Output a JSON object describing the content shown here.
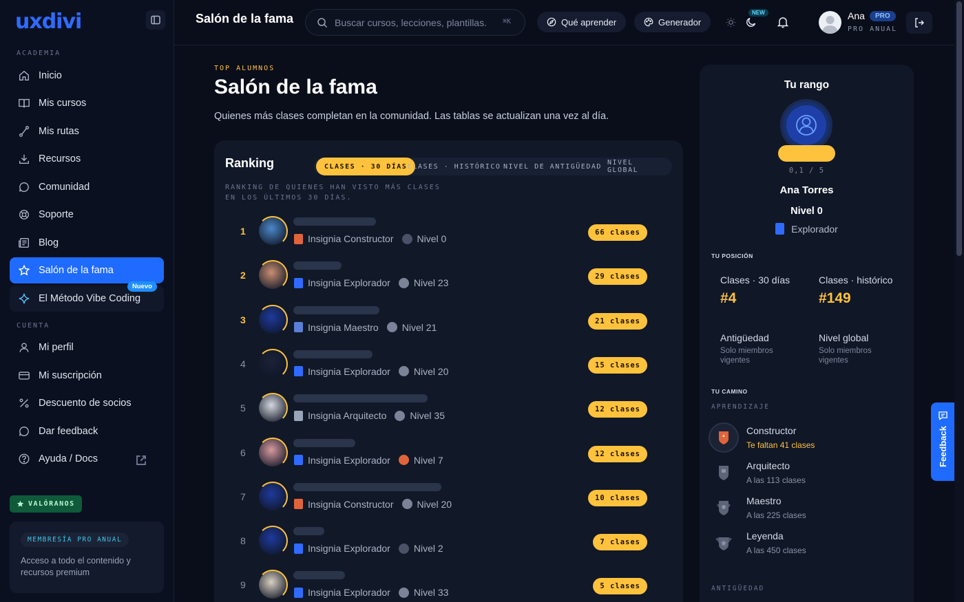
{
  "brand": {
    "logo_text": "uxdivi",
    "accent": "#1f6bff",
    "gold": "#ffc23d"
  },
  "sidebar": {
    "section_academia": "ACADEMIA",
    "items": [
      {
        "label": "Inicio",
        "icon": "home-icon"
      },
      {
        "label": "Mis cursos",
        "icon": "book-icon"
      },
      {
        "label": "Mis rutas",
        "icon": "route-icon"
      },
      {
        "label": "Recursos",
        "icon": "download-icon"
      },
      {
        "label": "Comunidad",
        "icon": "chat-icon"
      },
      {
        "label": "Soporte",
        "icon": "lifebuoy-icon"
      },
      {
        "label": "Blog",
        "icon": "newspaper-icon"
      },
      {
        "label": "Salón de la fama",
        "icon": "star-icon"
      },
      {
        "label": "El Método Vibe Coding",
        "icon": "sparkle-icon",
        "badge": "Nuevo"
      }
    ],
    "section_cuenta": "CUENTA",
    "account_items": [
      {
        "label": "Mi perfil",
        "icon": "user-icon"
      },
      {
        "label": "Mi suscripción",
        "icon": "card-icon"
      },
      {
        "label": "Descuento de socios",
        "icon": "percent-icon"
      },
      {
        "label": "Dar feedback",
        "icon": "chat-icon"
      },
      {
        "label": "Ayuda / Docs",
        "icon": "help-icon"
      }
    ],
    "valoranos": "VALÓRANOS",
    "membership": {
      "pill": "MEMBRESÍA PRO ANUAL",
      "desc": "Acceso a todo el contenido y recursos premium"
    }
  },
  "topbar": {
    "title": "Salón de la fama",
    "search_placeholder": "Buscar cursos, lecciones, plantillas...",
    "search_kbd": "⌘K",
    "que_aprender": "Qué aprender",
    "generador": "Generador",
    "new_badge": "NEW",
    "user": {
      "name": "Ana",
      "badge": "PRO",
      "plan": "PRO ANUAL"
    }
  },
  "main": {
    "eyebrow": "TOP ALUMNOS",
    "title": "Salón de la fama",
    "subtitle": "Quienes más clases completan en la comunidad. Las tablas se actualizan una vez al día."
  },
  "ranking": {
    "title": "Ranking",
    "tabs": [
      "CLASES · 30 DÍAS",
      "CLASES · HISTÓRICO",
      "NIVEL DE ANTIGÜEDAD",
      "NIVEL GLOBAL"
    ],
    "description": "RANKING DE QUIENES HAN VISTO MÁS CLASES EN LOS ÚLTIMOS 30 DÍAS.",
    "rows": [
      {
        "pos": "1",
        "insignia": "Insignia Constructor",
        "insignia_color": "#e0643a",
        "level": "Nivel 0",
        "level_color": "#4a5268",
        "classes": "66 clases",
        "avatar": "#4b87c7"
      },
      {
        "pos": "2",
        "insignia": "Insignia Explorador",
        "insignia_color": "#2f6bff",
        "level": "Nivel 23",
        "level_color": "#7a8398",
        "classes": "29 clases",
        "avatar": "#c98f72"
      },
      {
        "pos": "3",
        "insignia": "Insignia Maestro",
        "insignia_color": "#5b7fd6",
        "level": "Nivel 21",
        "level_color": "#7a8398",
        "classes": "21 clases",
        "avatar": "#1e3a9c"
      },
      {
        "pos": "4",
        "insignia": "Insignia Explorador",
        "insignia_color": "#2f6bff",
        "level": "Nivel 20",
        "level_color": "#7a8398",
        "classes": "15 clases",
        "avatar": "#1b2238"
      },
      {
        "pos": "5",
        "insignia": "Insignia Arquitecto",
        "insignia_color": "#9aa4b8",
        "level": "Nivel 35",
        "level_color": "#7a8398",
        "classes": "12 clases",
        "avatar": "#d5d8de"
      },
      {
        "pos": "6",
        "insignia": "Insignia Explorador",
        "insignia_color": "#2f6bff",
        "level": "Nivel 7",
        "level_color": "#e0643a",
        "classes": "12 clases",
        "avatar": "#d79a9e"
      },
      {
        "pos": "7",
        "insignia": "Insignia Constructor",
        "insignia_color": "#e0643a",
        "level": "Nivel 20",
        "level_color": "#7a8398",
        "classes": "10 clases",
        "avatar": "#1e3a9c"
      },
      {
        "pos": "8",
        "insignia": "Insignia Explorador",
        "insignia_color": "#2f6bff",
        "level": "Nivel 2",
        "level_color": "#4a5268",
        "classes": "7 clases",
        "avatar": "#1e3a9c"
      },
      {
        "pos": "9",
        "insignia": "Insignia Explorador",
        "insignia_color": "#2f6bff",
        "level": "Nivel 33",
        "level_color": "#7a8398",
        "classes": "5 clases",
        "avatar": "#d9d0c0"
      }
    ]
  },
  "rank_panel": {
    "title": "Tu rango",
    "xp": "0,1 / 5",
    "name": "Ana Torres",
    "level": "Nivel 0",
    "badge": "Explorador",
    "tu_posicion": "TU POSICIÓN",
    "stats": [
      {
        "label": "Clases · 30 días",
        "value": "#4"
      },
      {
        "label": "Clases · histórico",
        "value": "#149"
      },
      {
        "label": "Antigüedad",
        "sub": "Solo miembros vigentes"
      },
      {
        "label": "Nivel global",
        "sub": "Solo miembros vigentes"
      }
    ],
    "tu_camino": "TU CAMINO",
    "aprendizaje": "APRENDIZAJE",
    "path": [
      {
        "name": "Constructor",
        "sub": "Te faltan 41 clases"
      },
      {
        "name": "Arquitecto",
        "sub": "A las 113 clases"
      },
      {
        "name": "Maestro",
        "sub": "A las 225 clases"
      },
      {
        "name": "Leyenda",
        "sub": "A las 450 clases"
      }
    ],
    "antiguedad": "ANTIGÜEDAD"
  },
  "feedback_tab": "Feedback"
}
